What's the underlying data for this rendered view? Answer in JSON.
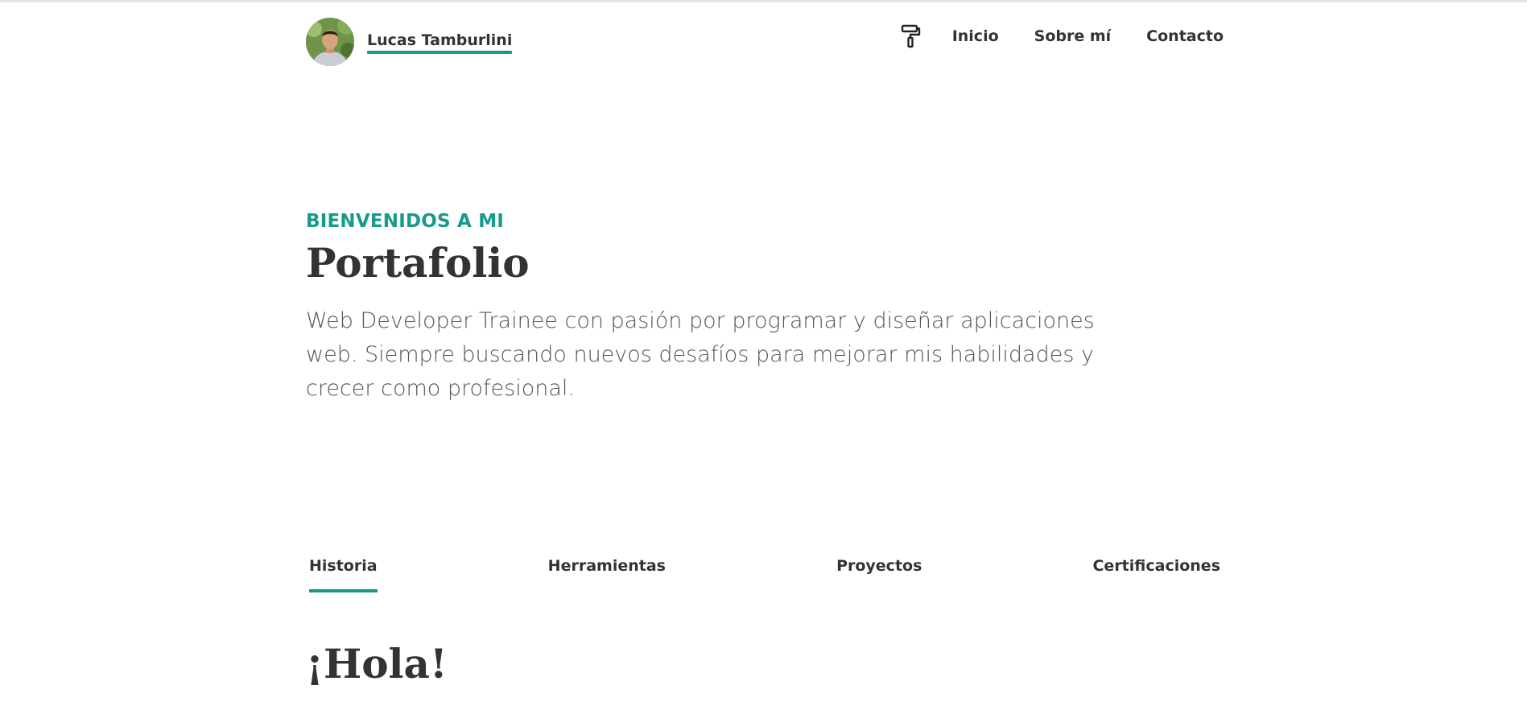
{
  "header": {
    "brand_name": "Lucas Tamburlini",
    "theme_icon": "paint-roller-icon",
    "nav": [
      {
        "label": "Inicio"
      },
      {
        "label": "Sobre mí"
      },
      {
        "label": "Contacto"
      }
    ]
  },
  "hero": {
    "eyebrow": "BIENVENIDOS A MI",
    "title": "Portafolio",
    "description": "Web Developer Trainee con pasión por programar y diseñar aplicaciones web. Siempre buscando nuevos desafíos para mejorar mis habilidades y crecer como profesional."
  },
  "tabs": [
    {
      "label": "Historia",
      "active": true
    },
    {
      "label": "Herramientas",
      "active": false
    },
    {
      "label": "Proyectos",
      "active": false
    },
    {
      "label": "Certificaciones",
      "active": false
    }
  ],
  "section": {
    "title": "¡Hola!"
  },
  "colors": {
    "accent": "#169a8a",
    "text": "#333333",
    "muted_text": "#555555",
    "background": "#ffffff"
  }
}
